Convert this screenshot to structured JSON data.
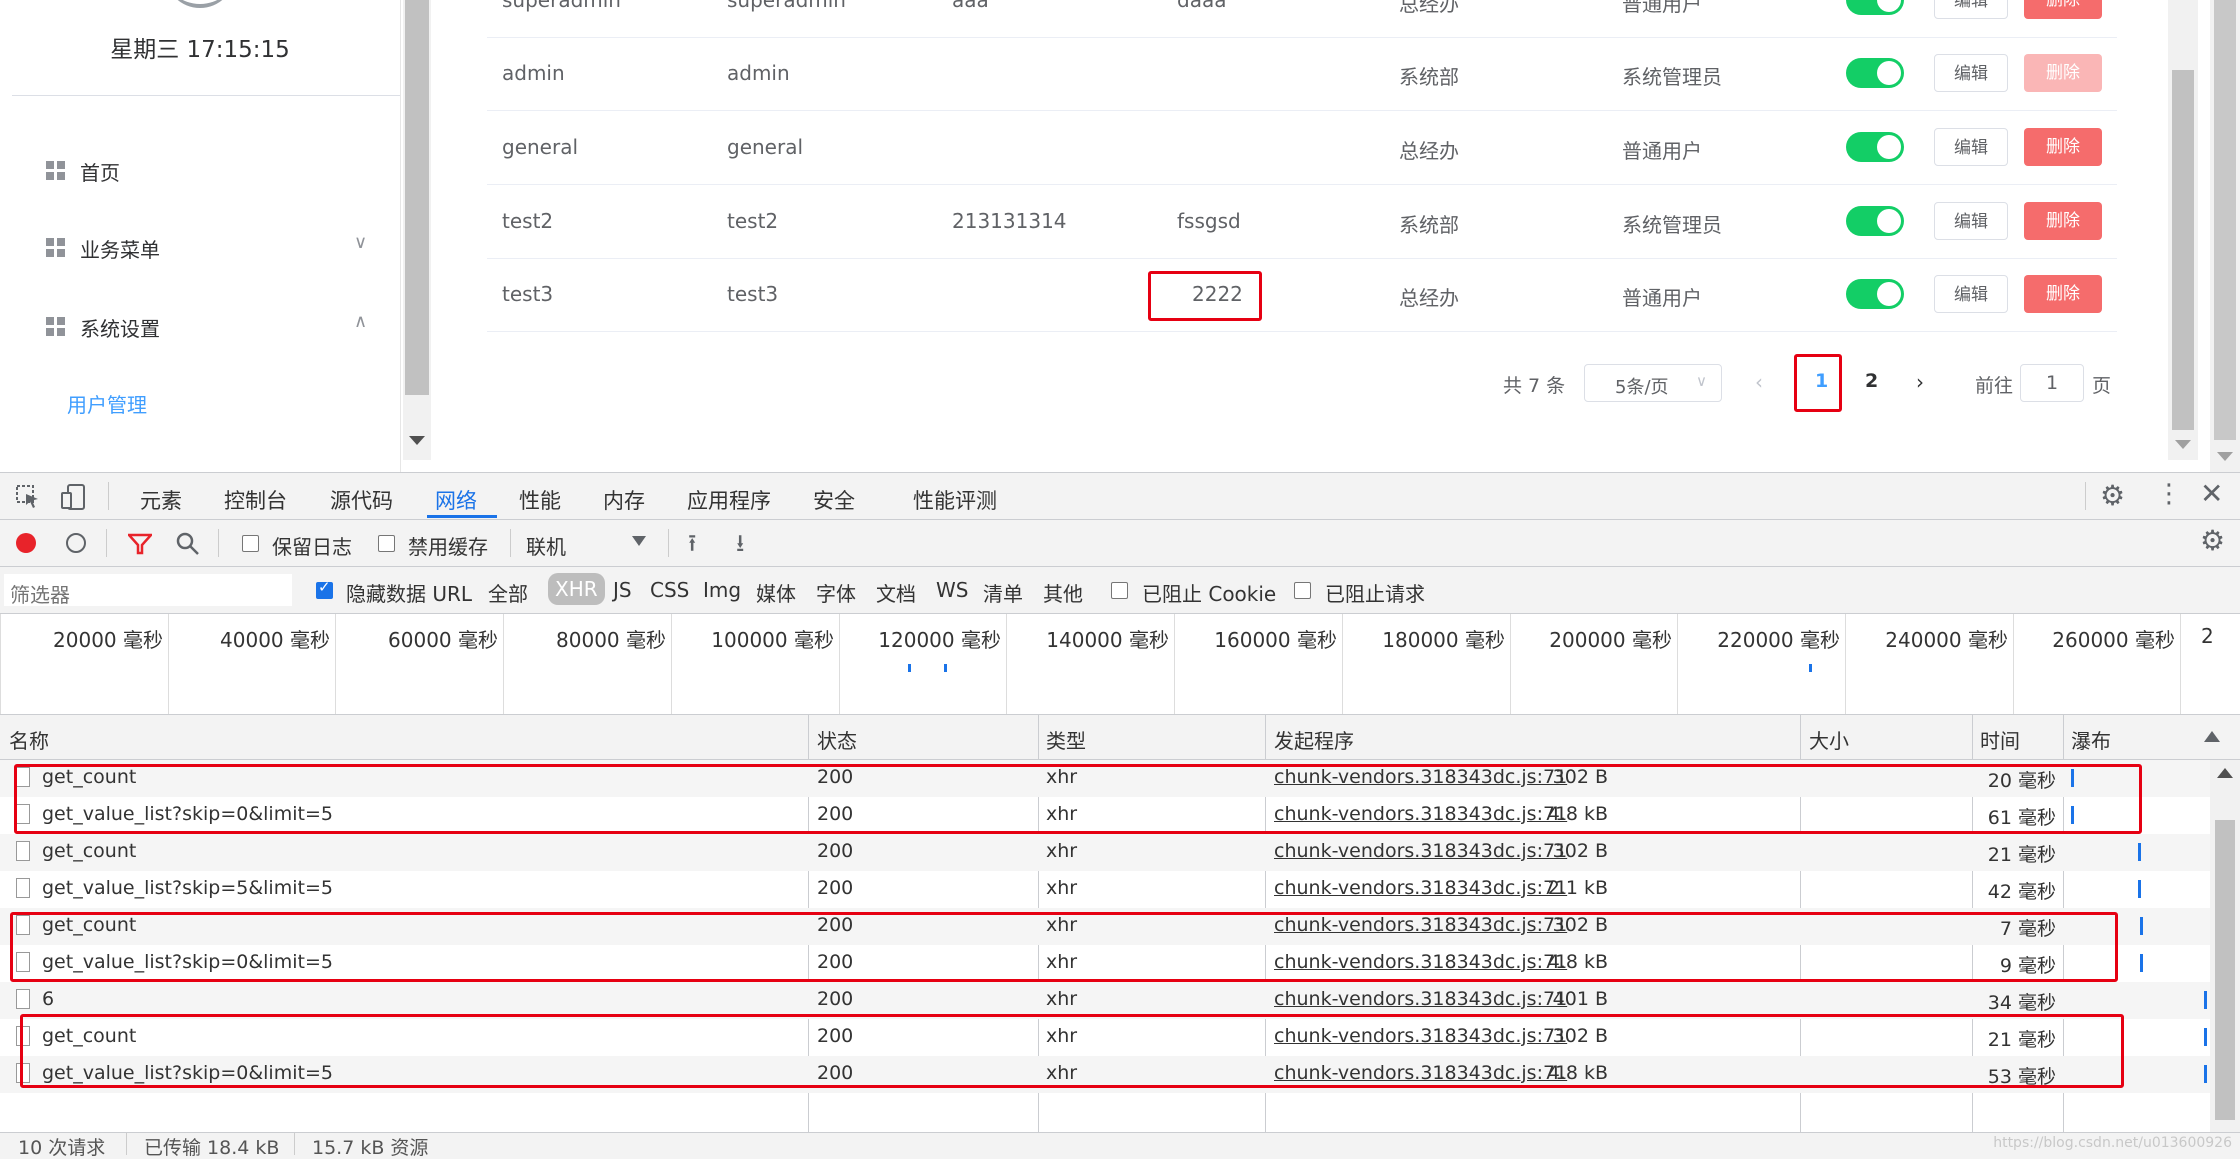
{
  "sidebar": {
    "clock": "星期三 17:15:15",
    "menu": [
      {
        "label": "首页"
      },
      {
        "label": "业务菜单",
        "chevron": "∨"
      },
      {
        "label": "系统设置",
        "chevron": "∧"
      }
    ],
    "submenu_active": "用户管理"
  },
  "table": {
    "rows": [
      {
        "c1": "superadmin",
        "c2": "superadmin",
        "c3": "aaa",
        "c4": "daaa",
        "c5": "总经办",
        "c6": "普通用户",
        "enabled": true,
        "edit": "编辑",
        "del": "删除"
      },
      {
        "c1": "admin",
        "c2": "admin",
        "c3": "",
        "c4": "",
        "c5": "系统部",
        "c6": "系统管理员",
        "enabled": true,
        "edit": "编辑",
        "del": "删除",
        "del_disabled": true
      },
      {
        "c1": "general",
        "c2": "general",
        "c3": "",
        "c4": "",
        "c5": "总经办",
        "c6": "普通用户",
        "enabled": true,
        "edit": "编辑",
        "del": "删除"
      },
      {
        "c1": "test2",
        "c2": "test2",
        "c3": "213131314",
        "c4": "fssgsd",
        "c5": "系统部",
        "c6": "系统管理员",
        "enabled": true,
        "edit": "编辑",
        "del": "删除"
      },
      {
        "c1": "test3",
        "c2": "test3",
        "c3": "",
        "c4": "2222",
        "c5": "总经办",
        "c6": "普通用户",
        "enabled": true,
        "edit": "编辑",
        "del": "删除"
      }
    ]
  },
  "pager": {
    "total": "共 7 条",
    "page_size": "5条/页",
    "prev": "‹",
    "pages": [
      "1",
      "2"
    ],
    "next": "›",
    "goto_label": "前往",
    "goto_value": "1",
    "page_suffix": "页"
  },
  "devtools": {
    "tabs": [
      "元素",
      "控制台",
      "源代码",
      "网络",
      "性能",
      "内存",
      "应用程序",
      "安全",
      "性能评测"
    ],
    "active_tab": "网络",
    "toolbar": {
      "preserve_log": "保留日志",
      "disable_cache": "禁用缓存",
      "throttle": "联机"
    },
    "filter": {
      "placeholder": "筛选器",
      "hide_data_urls": "隐藏数据 URL",
      "types": [
        "全部",
        "XHR",
        "JS",
        "CSS",
        "Img",
        "媒体",
        "字体",
        "文档",
        "WS",
        "清单",
        "其他"
      ],
      "active_type": "XHR",
      "blocked_cookies": "已阻止 Cookie",
      "blocked_requests": "已阻止请求"
    },
    "timeline_ticks": [
      "20000 毫秒",
      "40000 毫秒",
      "60000 毫秒",
      "80000 毫秒",
      "100000 毫秒",
      "120000 毫秒",
      "140000 毫秒",
      "160000 毫秒",
      "180000 毫秒",
      "200000 毫秒",
      "220000 毫秒",
      "240000 毫秒",
      "260000 毫秒",
      "2"
    ],
    "columns": [
      "名称",
      "状态",
      "类型",
      "发起程序",
      "大小",
      "时间",
      "瀑布"
    ],
    "requests": [
      {
        "name": "get_count",
        "status": "200",
        "type": "xhr",
        "initiator": "chunk-vendors.318343dc.js:71",
        "size": "302 B",
        "time": "20 毫秒"
      },
      {
        "name": "get_value_list?skip=0&limit=5",
        "status": "200",
        "type": "xhr",
        "initiator": "chunk-vendors.318343dc.js:71",
        "size": "4.8 kB",
        "time": "61 毫秒"
      },
      {
        "name": "get_count",
        "status": "200",
        "type": "xhr",
        "initiator": "chunk-vendors.318343dc.js:71",
        "size": "302 B",
        "time": "21 毫秒"
      },
      {
        "name": "get_value_list?skip=5&limit=5",
        "status": "200",
        "type": "xhr",
        "initiator": "chunk-vendors.318343dc.js:71",
        "size": "2.1 kB",
        "time": "42 毫秒"
      },
      {
        "name": "get_count",
        "status": "200",
        "type": "xhr",
        "initiator": "chunk-vendors.318343dc.js:71",
        "size": "302 B",
        "time": "7 毫秒"
      },
      {
        "name": "get_value_list?skip=0&limit=5",
        "status": "200",
        "type": "xhr",
        "initiator": "chunk-vendors.318343dc.js:71",
        "size": "4.8 kB",
        "time": "9 毫秒"
      },
      {
        "name": "6",
        "status": "200",
        "type": "xhr",
        "initiator": "chunk-vendors.318343dc.js:71",
        "size": "401 B",
        "time": "34 毫秒"
      },
      {
        "name": "get_count",
        "status": "200",
        "type": "xhr",
        "initiator": "chunk-vendors.318343dc.js:71",
        "size": "302 B",
        "time": "21 毫秒"
      },
      {
        "name": "get_value_list?skip=0&limit=5",
        "status": "200",
        "type": "xhr",
        "initiator": "chunk-vendors.318343dc.js:71",
        "size": "4.8 kB",
        "time": "53 毫秒"
      }
    ],
    "status_bar": [
      "10 次请求",
      "已传输 18.4 kB",
      "15.7 kB 资源"
    ]
  },
  "colors": {
    "accent": "#409eff",
    "switch_on": "#13ce66",
    "danger": "#f56c6c",
    "danger_disabled": "#fab6b6",
    "highlight_box": "#e60012",
    "devtools_blue": "#1a73e8"
  },
  "watermark": "https://blog.csdn.net/u013600926"
}
